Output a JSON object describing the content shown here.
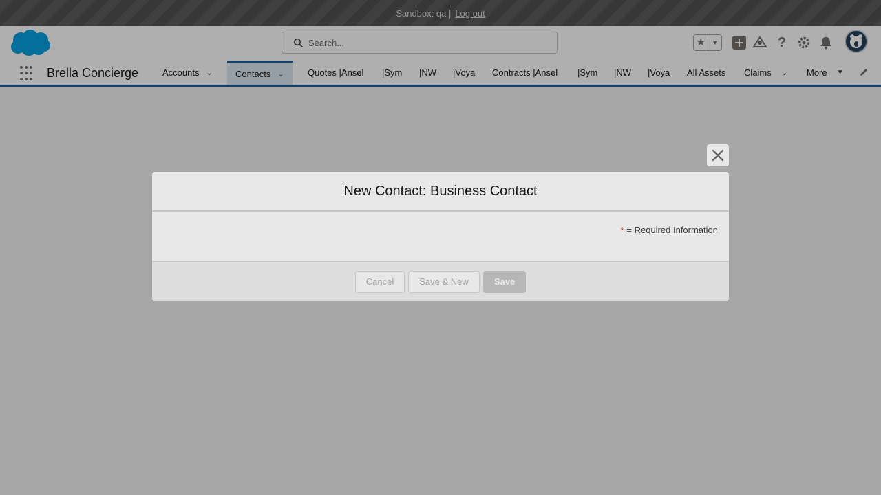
{
  "sandbox": {
    "text": "Sandbox: qa |",
    "logout": "Log out"
  },
  "header": {
    "search_placeholder": "Search...",
    "icons": [
      "favorites-star-icon",
      "favorites-dropdown-icon",
      "add-icon",
      "trailhead-icon",
      "help-icon",
      "setup-gear-icon",
      "notifications-bell-icon",
      "avatar"
    ]
  },
  "nav": {
    "app_name": "Brella Concierge",
    "items": [
      {
        "label": "Accounts",
        "has_menu": true
      },
      {
        "label": "Contacts",
        "has_menu": true,
        "active": true
      },
      {
        "label": "Quotes |Ansel",
        "has_menu": false
      },
      {
        "label": "|Sym",
        "has_menu": false
      },
      {
        "label": "|NW",
        "has_menu": false
      },
      {
        "label": "|Voya",
        "has_menu": false
      },
      {
        "label": "Contracts |Ansel",
        "has_menu": false
      },
      {
        "label": "|Sym",
        "has_menu": false
      },
      {
        "label": "|NW",
        "has_menu": false
      },
      {
        "label": "|Voya",
        "has_menu": false
      },
      {
        "label": "All Assets",
        "has_menu": false
      },
      {
        "label": "Claims",
        "has_menu": true
      },
      {
        "label": "More",
        "has_menu": true
      }
    ]
  },
  "modal": {
    "title": "New Contact: Business Contact",
    "required_star": "*",
    "required_text": "= Required Information",
    "buttons": {
      "cancel": "Cancel",
      "save_new": "Save & New",
      "save": "Save"
    }
  },
  "colors": {
    "brand_blue": "#1b5f9e",
    "salesforce_cloud": "#00a1e0",
    "required_red": "#c23934"
  }
}
